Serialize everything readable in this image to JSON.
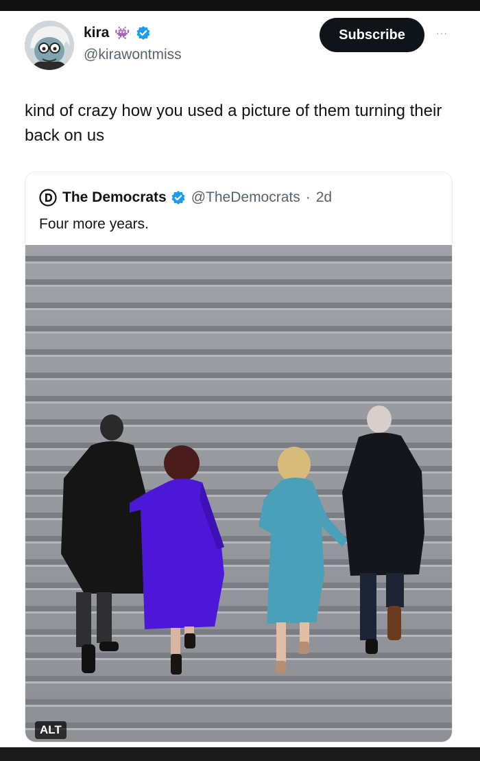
{
  "author": {
    "display_name": "kira",
    "emoji_badge": "👾",
    "handle": "@kirawontmiss"
  },
  "actions": {
    "subscribe_label": "Subscribe",
    "more_label": "···"
  },
  "tweet": {
    "text": "kind of crazy how you used a picture of them turning their back on us"
  },
  "quoted_tweet": {
    "display_name": "The Democrats",
    "handle": "@TheDemocrats",
    "separator": "·",
    "age": "2d",
    "text": "Four more years.",
    "alt_badge": "ALT"
  },
  "colors": {
    "verified_blue": "#1d9bf0",
    "subscribe_bg": "#0f1419",
    "handle_gray": "#536471"
  },
  "icons": {
    "verified": "verified-badge-icon",
    "party_logo": "democrats-logo-icon",
    "more": "more-options-icon"
  }
}
